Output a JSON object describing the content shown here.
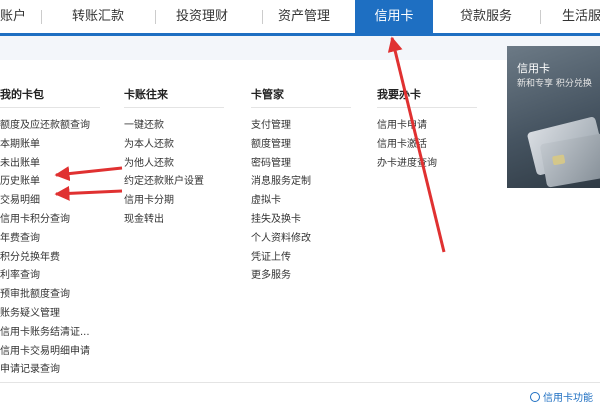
{
  "nav": {
    "tabs": [
      {
        "label": "账户"
      },
      {
        "label": "转账汇款"
      },
      {
        "label": "投资理财"
      },
      {
        "label": "资产管理"
      },
      {
        "label": "信用卡"
      },
      {
        "label": "贷款服务"
      },
      {
        "label": "生活服务"
      }
    ],
    "active_tab": "信用卡"
  },
  "menu": {
    "columns": [
      {
        "title": "我的卡包",
        "items": [
          "额度及应还款额查询",
          "本期账单",
          "未出账单",
          "历史账单",
          "交易明细",
          "信用卡积分查询",
          "年费查询",
          "积分兑换年费",
          "利率查询",
          "预审批额度查询",
          "账务疑义管理",
          "信用卡账务结清证...",
          "信用卡交易明细申请",
          "申请记录查询"
        ]
      },
      {
        "title": "卡账往来",
        "items": [
          "一键还款",
          "为本人还款",
          "为他人还款",
          "约定还款账户设置",
          "信用卡分期",
          "现金转出"
        ]
      },
      {
        "title": "卡管家",
        "items": [
          "支付管理",
          "额度管理",
          "密码管理",
          "消息服务定制",
          "虚拟卡",
          "挂失及换卡",
          "个人资料修改",
          "凭证上传",
          "更多服务"
        ]
      },
      {
        "title": "我要办卡",
        "items": [
          "信用卡申请",
          "信用卡激活",
          "办卡进度查询"
        ]
      }
    ]
  },
  "promo": {
    "title": "信用卡",
    "subtitle": "新和专享 积分兑换"
  },
  "footer": {
    "link": "信用卡功能"
  },
  "colors": {
    "accent": "#1e6fc2",
    "annotation": "#e03131"
  }
}
